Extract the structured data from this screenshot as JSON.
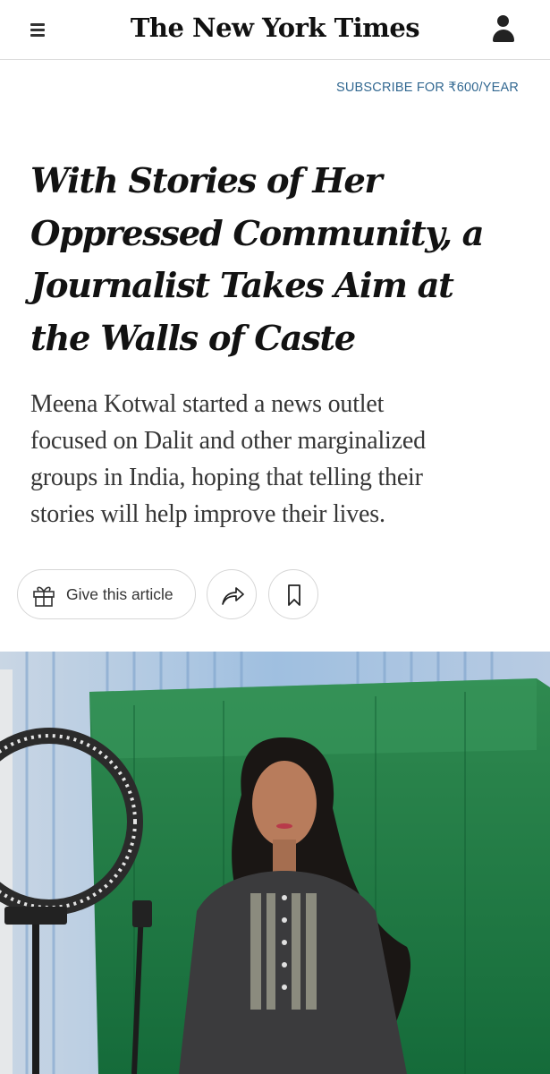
{
  "header": {
    "masthead": "The New York Times",
    "menu_icon": "hamburger-menu-icon",
    "account_icon": "user-account-icon"
  },
  "subscribe": {
    "label": "SUBSCRIBE FOR ₹600/YEAR"
  },
  "article": {
    "headline_lines": [
      "With Stories of Her",
      "Oppressed Community, a",
      "Journalist Takes Aim at",
      "the Walls of Caste"
    ],
    "summary_lines": [
      "Meena Kotwal started a news outlet",
      "focused on Dalit and other marginalized",
      "groups in India, hoping that telling their",
      "stories will help improve their lives."
    ]
  },
  "actions": {
    "gift_label": "Give this article",
    "gift_icon": "gift-icon",
    "share_icon": "share-icon",
    "save_icon": "bookmark-icon"
  },
  "colors": {
    "link_blue": "#326891",
    "green_screen": "#1f7a45",
    "wall_blue": "#8fb3d9",
    "shirt": "#3b3b3d"
  }
}
